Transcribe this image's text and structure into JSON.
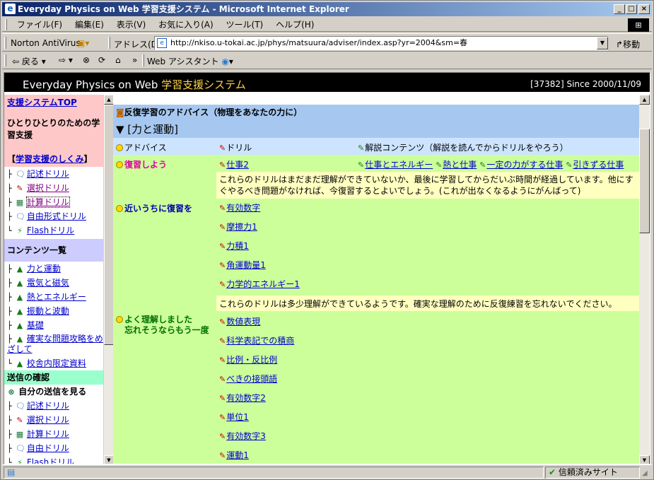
{
  "window": {
    "title": "Everyday Physics on Web 学習支援システム - Microsoft Internet Explorer",
    "min": "_",
    "max": "□",
    "close": "×"
  },
  "menu": [
    "ファイル(F)",
    "編集(E)",
    "表示(V)",
    "お気に入り(A)",
    "ツール(T)",
    "ヘルプ(H)"
  ],
  "addressbar": {
    "norton": "Norton AntiVirus",
    "address_label": "アドレス(D)",
    "url": "http://nkiso.u-tokai.ac.jp/phys/matsuura/adviser/index.asp?yr=2004&sm=春",
    "go": "移動"
  },
  "toolbar": {
    "back": "戻る",
    "webassist": "Web アシスタント"
  },
  "banner": {
    "title_en": "Everyday Physics on Web ",
    "title_ja": "学習支援",
    "title_ja2": "システム",
    "counter": "[37382]  Since 2000/11/09"
  },
  "sidebar": {
    "top_link": "支援システムTOP",
    "intro": "ひとりひとりのための学習支援",
    "mech_link": "学習支援のしくみ",
    "drills": [
      {
        "icon": "speech-icon",
        "label": "記述ドリル",
        "glyph": "🗨"
      },
      {
        "icon": "pencil-icon",
        "label": "選択ドリル",
        "glyph": "✎"
      },
      {
        "icon": "calculator-icon",
        "label": "計算ドリル",
        "glyph": "▦"
      },
      {
        "icon": "speech-icon",
        "label": "自由形式ドリル",
        "glyph": "🗨"
      },
      {
        "icon": "flash-icon",
        "label": "Flashドリル",
        "glyph": "⚡"
      }
    ],
    "contents_header": "コンテンツ一覧",
    "contents": [
      "力と運動",
      "電気と磁気",
      "熱とエネルギー",
      "振動と波動",
      "基礎",
      "確実な問題攻略をめざして",
      "校舎内限定資料"
    ],
    "send_header": "送信の確認",
    "send_self": "自分の送信を見る",
    "send_drills": [
      "記述ドリル",
      "選択ドリル",
      "計算ドリル",
      "自由ドリル",
      "Flashドリル"
    ]
  },
  "main": {
    "section_title": "反復学習のアドバイス（物理をあなたの力に）",
    "topic": "▼ [力と運動]",
    "header": {
      "advice": "アドバイス",
      "drill": "ドリル",
      "content": "解説コンテンツ（解説を読んでからドリルをやろう）"
    },
    "review_now": {
      "label": "復習しよう",
      "drills": [
        "仕事2"
      ],
      "contents": [
        "仕事とエネルギー",
        "熱と仕事",
        "一定の力がする仕事",
        "引きずる仕事"
      ],
      "message": "これらのドリルはまだまだ理解ができていないか、最後に学習してからだいぶ時間が経過しています。他にすぐやるべき問題がなければ、今復習するとよいでしょう。(これが出なくなるようにがんばって)"
    },
    "review_soon": {
      "label": "近いうちに復習を",
      "drills": [
        "有効数字",
        "摩擦力1",
        "力積1",
        "角運動量1",
        "力学的エネルギー1"
      ],
      "message": "これらのドリルは多少理解ができているようです。確実な理解のために反復練習を忘れないでください。"
    },
    "understood": {
      "label1": "よく理解しました",
      "label2": "忘れそうならもう一度",
      "drills": [
        "数値表現",
        "科学表記での積商",
        "比例・反比例",
        "べきの接頭語",
        "有効数字2",
        "単位1",
        "有効数字3",
        "運動1"
      ]
    }
  },
  "status": {
    "trusted": "信頼済みサイト"
  },
  "colors": {
    "banner": "#000000",
    "section": "#a6c8f0",
    "header_row": "#cce4ff",
    "review_now": "#ffffc0",
    "green": "#ccff99",
    "side_pink": "#ffc8c8",
    "side_lavender": "#ccccff",
    "side_mint": "#99ffcc"
  }
}
